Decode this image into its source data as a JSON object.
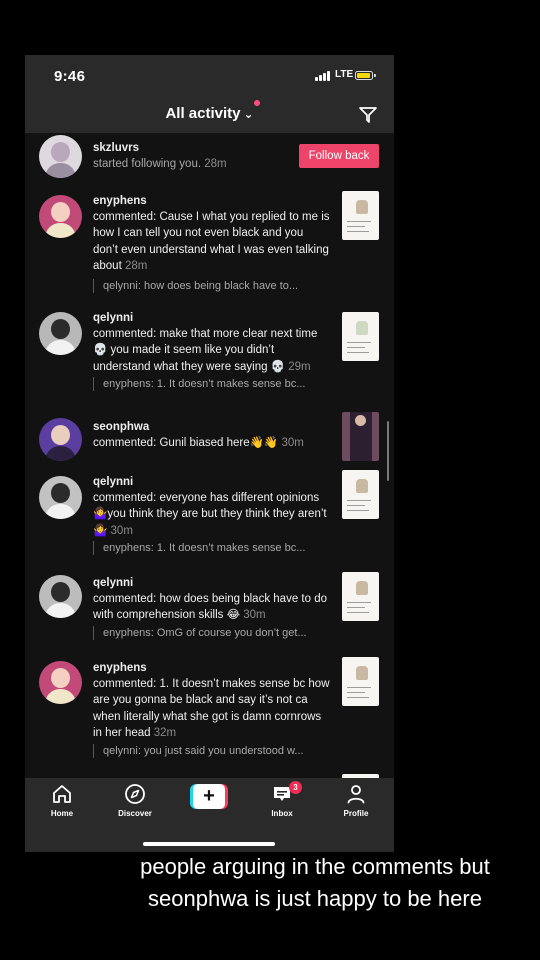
{
  "status_bar": {
    "time": "9:46",
    "network": "LTE"
  },
  "header": {
    "title": "All activity"
  },
  "activity": [
    {
      "username": "skzluvrs",
      "text": "started following you.",
      "time": "28m",
      "action": "Follow back"
    },
    {
      "username": "enyphens",
      "text": "commented: Cause I what you replied to me is how I can tell you not even black and you don’t even understand what I was even talking about",
      "time": "28m",
      "quote": "qelynni: how does being black have to..."
    },
    {
      "username": "qelynni",
      "text": "commented: make that more clear next time 💀 you made it seem like you didn’t understand what they were saying 💀",
      "time": "29m",
      "quote": "enyphens: 1. It doesn’t makes sense bc..."
    },
    {
      "username": "seonphwa",
      "text": "commented: Gunil biased here👋👋",
      "time": "30m"
    },
    {
      "username": "qelynni",
      "text": "commented: everyone has different opinions 🤷‍♀️you think they are but they think they aren’t 🤷‍♀️",
      "time": "30m",
      "quote": "enyphens: 1. It doesn’t makes sense bc..."
    },
    {
      "username": "qelynni",
      "text": "commented: how does being black have to do with comprehension skills 😂",
      "time": "30m",
      "quote": "enyphens: OmG of course you don’t get..."
    },
    {
      "username": "enyphens",
      "text": "commented: 1. It doesn’t makes sense bc how are you gonna be black and say it’s not ca when literally what she got is damn cornrows in her head",
      "time": "32m",
      "quote": "qelynni: you just said you understood w..."
    }
  ],
  "tabs": {
    "home": "Home",
    "discover": "Discover",
    "inbox": "Inbox",
    "inbox_badge": "3",
    "profile": "Profile"
  },
  "caption": "people arguing in the comments but seonphwa is just happy to be here",
  "colors": {
    "accent": "#ee4469",
    "background": "#121212",
    "bar": "#2a2a2a",
    "battery": "#f5d90a"
  },
  "icons": [
    "filter-icon",
    "home-icon",
    "discover-icon",
    "plus-icon",
    "inbox-icon",
    "profile-icon"
  ]
}
